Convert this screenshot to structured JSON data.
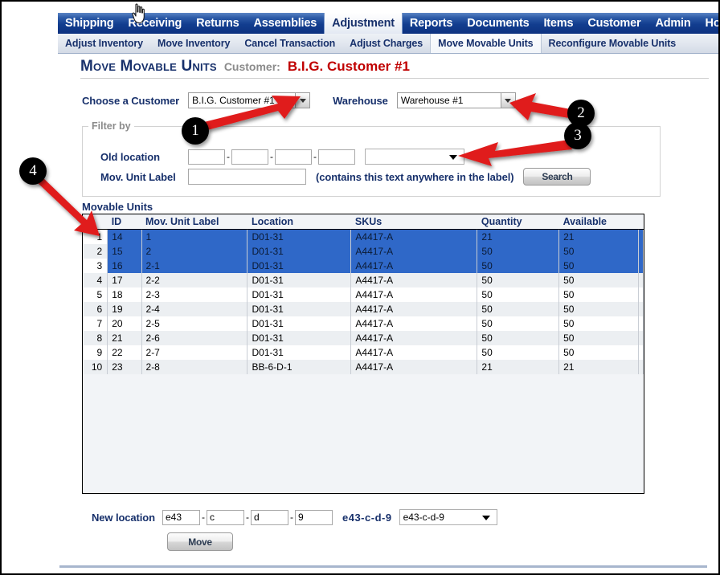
{
  "nav": {
    "items": [
      {
        "label": "Shipping",
        "active": false
      },
      {
        "label": "Receiving",
        "active": false
      },
      {
        "label": "Returns",
        "active": false
      },
      {
        "label": "Assemblies",
        "active": false
      },
      {
        "label": "Adjustment",
        "active": true
      },
      {
        "label": "Reports",
        "active": false
      },
      {
        "label": "Documents",
        "active": false
      },
      {
        "label": "Items",
        "active": false
      },
      {
        "label": "Customer",
        "active": false
      },
      {
        "label": "Admin",
        "active": false
      },
      {
        "label": "Home",
        "active": false
      }
    ]
  },
  "subnav": {
    "items": [
      {
        "label": "Adjust Inventory",
        "active": false
      },
      {
        "label": "Move Inventory",
        "active": false
      },
      {
        "label": "Cancel Transaction",
        "active": false
      },
      {
        "label": "Adjust Charges",
        "active": false
      },
      {
        "label": "Move Movable Units",
        "active": true
      },
      {
        "label": "Reconfigure Movable Units",
        "active": false
      }
    ]
  },
  "header": {
    "title": "Move Movable Units",
    "customer_label": "Customer:",
    "customer_name": "B.I.G. Customer #1"
  },
  "form": {
    "customer_label": "Choose a Customer",
    "customer_value": "B.I.G. Customer #1",
    "warehouse_label": "Warehouse",
    "warehouse_value": "Warehouse #1"
  },
  "filter": {
    "legend": "Filter by",
    "old_location_label": "Old location",
    "old_location_parts": [
      "",
      "",
      "",
      ""
    ],
    "old_location_dropdown_value": "",
    "mov_unit_label": "Mov. Unit Label",
    "mov_unit_value": "",
    "hint": "(contains this text anywhere in the label)",
    "search_button": "Search"
  },
  "table": {
    "caption": "Movable Units",
    "columns": [
      "",
      "ID",
      "Mov. Unit Label",
      "Location",
      "SKUs",
      "Quantity",
      "Available",
      ""
    ],
    "rows": [
      {
        "n": "1",
        "id": "14",
        "label": "1",
        "location": "D01-31",
        "skus": "A4417-A",
        "quantity": "21",
        "available": "21",
        "selected": true
      },
      {
        "n": "2",
        "id": "15",
        "label": "2",
        "location": "D01-31",
        "skus": "A4417-A",
        "quantity": "50",
        "available": "50",
        "selected": true
      },
      {
        "n": "3",
        "id": "16",
        "label": "2-1",
        "location": "D01-31",
        "skus": "A4417-A",
        "quantity": "50",
        "available": "50",
        "selected": true
      },
      {
        "n": "4",
        "id": "17",
        "label": "2-2",
        "location": "D01-31",
        "skus": "A4417-A",
        "quantity": "50",
        "available": "50",
        "selected": false
      },
      {
        "n": "5",
        "id": "18",
        "label": "2-3",
        "location": "D01-31",
        "skus": "A4417-A",
        "quantity": "50",
        "available": "50",
        "selected": false
      },
      {
        "n": "6",
        "id": "19",
        "label": "2-4",
        "location": "D01-31",
        "skus": "A4417-A",
        "quantity": "50",
        "available": "50",
        "selected": false
      },
      {
        "n": "7",
        "id": "20",
        "label": "2-5",
        "location": "D01-31",
        "skus": "A4417-A",
        "quantity": "50",
        "available": "50",
        "selected": false
      },
      {
        "n": "8",
        "id": "21",
        "label": "2-6",
        "location": "D01-31",
        "skus": "A4417-A",
        "quantity": "50",
        "available": "50",
        "selected": false
      },
      {
        "n": "9",
        "id": "22",
        "label": "2-7",
        "location": "D01-31",
        "skus": "A4417-A",
        "quantity": "50",
        "available": "50",
        "selected": false
      },
      {
        "n": "10",
        "id": "23",
        "label": "2-8",
        "location": "BB-6-D-1",
        "skus": "A4417-A",
        "quantity": "21",
        "available": "21",
        "selected": false
      }
    ]
  },
  "newloc": {
    "label": "New location",
    "parts": [
      "e43",
      "c",
      "d",
      "9"
    ],
    "preview": "e43-c-d-9",
    "dropdown_value": "e43-c-d-9",
    "move_button": "Move"
  },
  "annotations": {
    "callouts": [
      {
        "number": "1"
      },
      {
        "number": "2"
      },
      {
        "number": "3"
      },
      {
        "number": "4"
      }
    ],
    "arrow_color": "#e01b1b"
  },
  "colors": {
    "nav_blue": "#123d8f",
    "heading_navy": "#17306b",
    "customer_red": "#c00000",
    "row_selected": "#2f68c8",
    "row_alt": "#eceff2"
  }
}
